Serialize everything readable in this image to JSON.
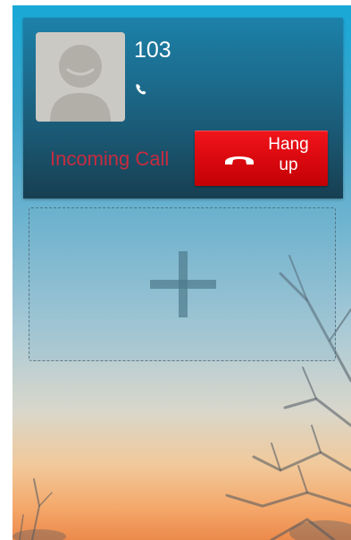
{
  "call": {
    "number": "103",
    "status": "Incoming Call",
    "hangup_label": "Hang\nup",
    "icons": {
      "avatar": "person-silhouette",
      "call_type": "phone-handset",
      "hangup": "phone-hangup",
      "add": "plus"
    }
  },
  "colors": {
    "status_text": "#c72c3f",
    "hangup_button": "#e20b10",
    "card_background": "#1b5f7c"
  }
}
